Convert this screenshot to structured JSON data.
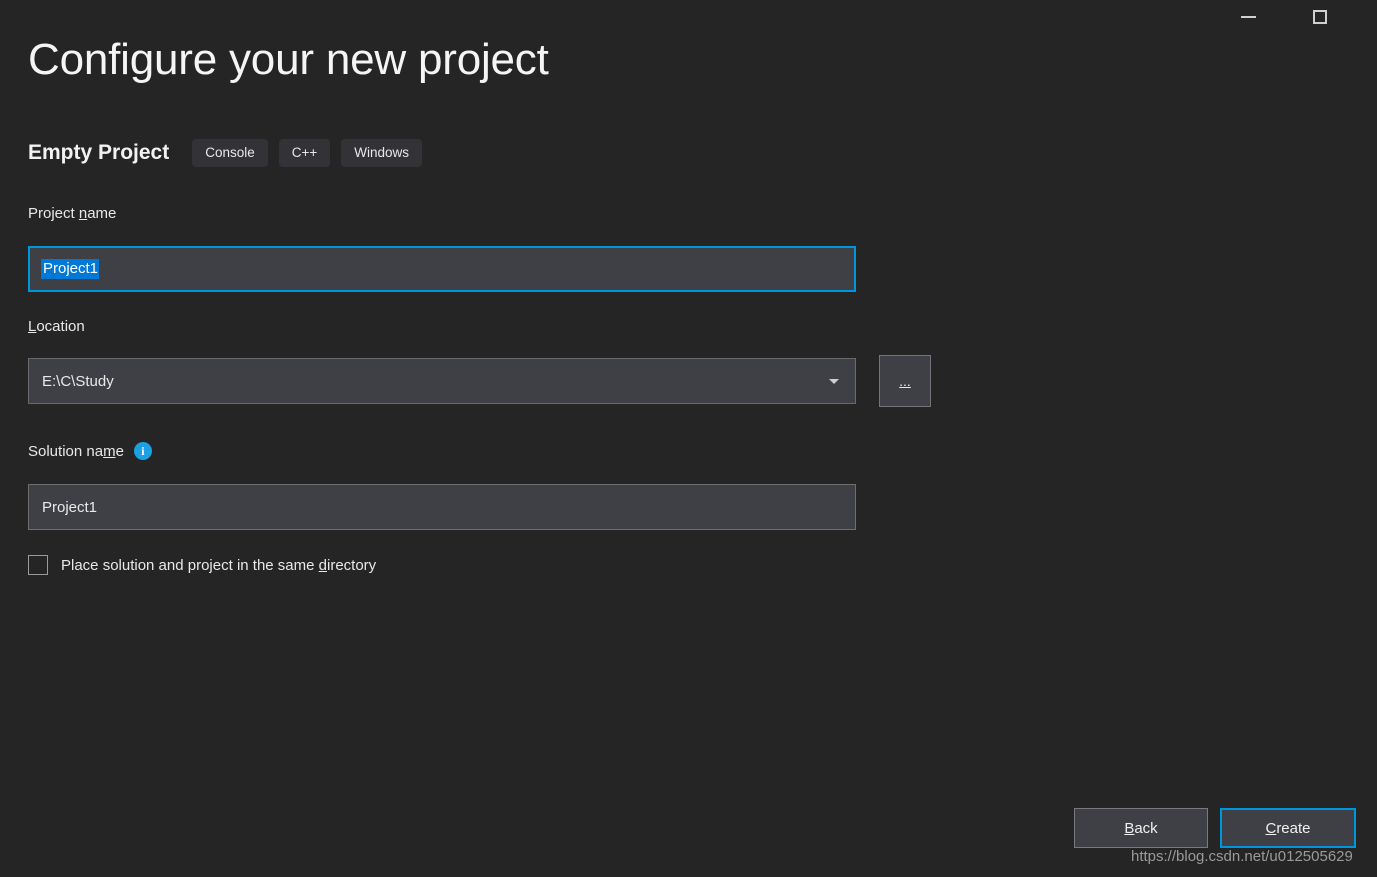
{
  "window": {
    "minimize_icon": "minimize-icon",
    "maximize_icon": "maximize-icon"
  },
  "header": {
    "title": "Configure your new project",
    "template_name": "Empty Project",
    "tags": [
      "Console",
      "C++",
      "Windows"
    ]
  },
  "form": {
    "project_name": {
      "label_before": "Project ",
      "label_accesskey": "n",
      "label_after": "ame",
      "value": "Project1",
      "selected": true
    },
    "location": {
      "label_accesskey": "L",
      "label_after": "ocation",
      "value": "E:\\C\\Study",
      "dropdown_icon": "chevron-down-icon",
      "browse_label": "...",
      "browse_icon": "ellipsis-icon"
    },
    "solution_name": {
      "label_before": "Solution na",
      "label_accesskey": "m",
      "label_after": "e",
      "value": "Project1",
      "info_icon": "info-icon",
      "info_glyph": "i"
    },
    "same_directory_checkbox": {
      "label_before": "Place solution and project in the same ",
      "label_accesskey": "d",
      "label_after": "irectory",
      "checked": false
    }
  },
  "footer": {
    "back": {
      "label_accesskey": "B",
      "label_after": "ack"
    },
    "create": {
      "label_accesskey": "C",
      "label_after": "reate"
    }
  },
  "watermark": "https://blog.csdn.net/u012505629",
  "colors": {
    "background": "#252526",
    "input_background": "#3f4046",
    "focus_border": "#0096dd",
    "selection_blue": "#0078d7",
    "tag_background": "#333337",
    "info_blue": "#1ba1e2",
    "button_background": "#3f3f46"
  }
}
